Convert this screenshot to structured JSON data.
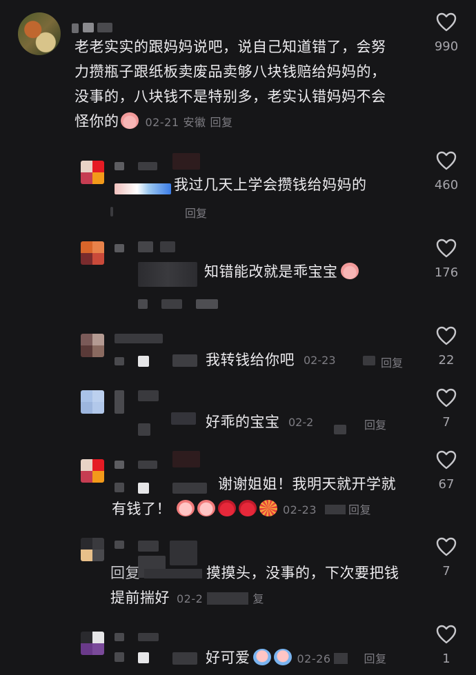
{
  "comments": [
    {
      "text_lines": [
        "老老实实的跟妈妈说吧，说自己知道错了，会努",
        "力攒瓶子跟纸板卖废品卖够八块钱赔给妈妈的，",
        "没事的，八块钱不是特别多，老实认错妈妈不会",
        "怪你的"
      ],
      "date": "02-21",
      "location": "安徽",
      "reply": "回复",
      "likes": "990"
    },
    {
      "text": "我过几天上学会攒钱给妈妈的",
      "reply": "回复",
      "likes": "460"
    },
    {
      "text": "知错能改就是乖宝宝",
      "likes": "176"
    },
    {
      "text": "我转钱给你吧",
      "date": "02-23",
      "reply": "回复",
      "likes": "22"
    },
    {
      "text": "好乖的宝宝",
      "date": "02-2",
      "reply": "回复",
      "likes": "7"
    },
    {
      "text_lines": [
        "谢谢姐姐！我明天就开学就",
        "有钱了！"
      ],
      "date": "02-23",
      "reply": "回复",
      "likes": "67"
    },
    {
      "text_lines": [
        "摸摸头，没事的，下次要把钱",
        "提前揣好"
      ],
      "prefix": "回复",
      "date": "02-2",
      "reply": "复",
      "likes": "7"
    },
    {
      "text": "好可爱",
      "date": "02-26",
      "reply": "回复",
      "likes": "1"
    }
  ],
  "icons": {
    "like": "heart-outline-icon",
    "emoji_pig": "pig-face-emoji",
    "emoji_cry": "crying-face-emoji",
    "emoji_strawberry": "strawberry-emoji",
    "emoji_firework": "firework-emoji"
  },
  "colors": {
    "background": "#161618",
    "text": "#ecebee",
    "meta": "#7d7c82",
    "count": "#a6a5ab"
  }
}
